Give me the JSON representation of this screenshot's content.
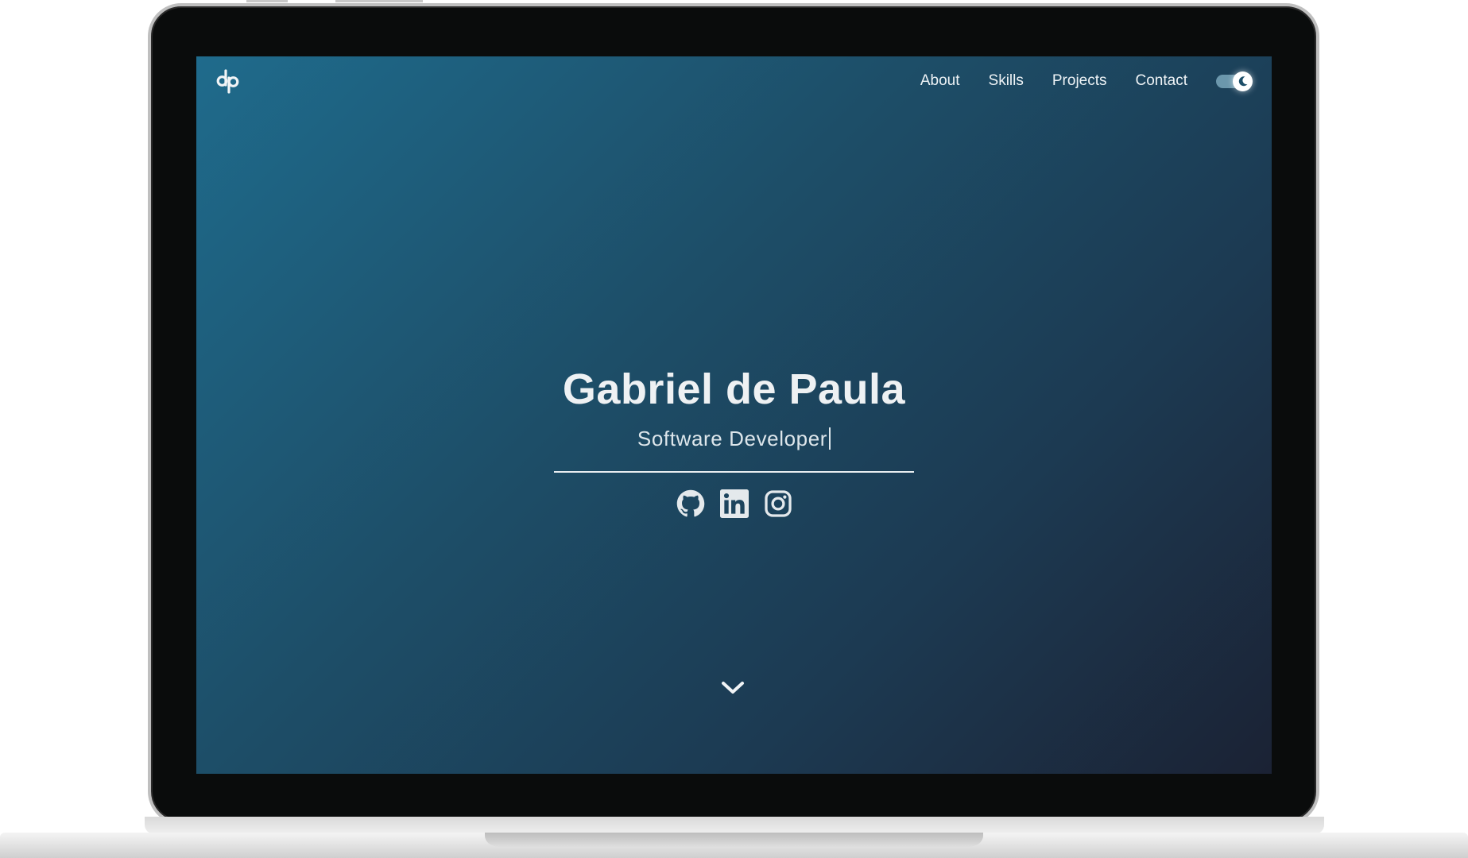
{
  "header": {
    "logo_alt": "dp logo",
    "nav": [
      {
        "label": "About"
      },
      {
        "label": "Skills"
      },
      {
        "label": "Projects"
      },
      {
        "label": "Contact"
      }
    ],
    "theme_toggle": {
      "state": "dark",
      "icon": "moon-icon"
    }
  },
  "hero": {
    "name": "Gabriel de Paula",
    "role": "Software Developer",
    "socials": [
      {
        "icon": "github-icon"
      },
      {
        "icon": "linkedin-icon"
      },
      {
        "icon": "instagram-icon"
      }
    ],
    "scroll_icon": "chevron-down-icon"
  },
  "colors": {
    "gradient_start": "#1f6b8c",
    "gradient_end": "#1b2234",
    "text": "#eef1f3",
    "toggle_track": "#6b97ac"
  }
}
